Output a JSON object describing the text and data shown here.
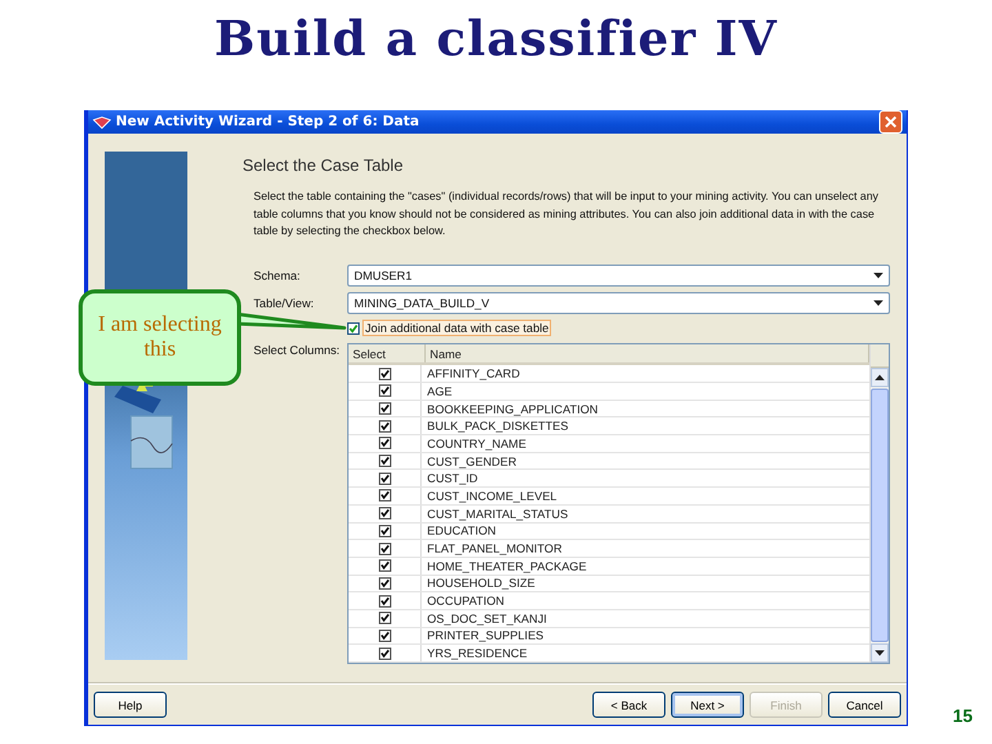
{
  "slide": {
    "title": "Build a classifier IV",
    "page_number": "15"
  },
  "callout": {
    "text": "I am selecting this"
  },
  "window": {
    "title": "New Activity Wizard - Step 2 of 6: Data"
  },
  "step": {
    "heading": "Select the Case Table",
    "description": "Select the table containing the \"cases\" (individual records/rows) that will be input to your mining activity.  You can unselect any table columns that you know should not be considered as mining attributes.  You can also join additional data in with the case table by selecting the checkbox below."
  },
  "form": {
    "schema": {
      "label": "Schema:",
      "value": "DMUSER1"
    },
    "table_view": {
      "label": "Table/View:",
      "value": "MINING_DATA_BUILD_V"
    },
    "join": {
      "label": "Join additional data with case table",
      "checked": true
    },
    "columns_label": "Select Columns:"
  },
  "table": {
    "columns": [
      "Select",
      "Name"
    ],
    "rows": [
      {
        "checked": true,
        "name": "AFFINITY_CARD"
      },
      {
        "checked": true,
        "name": "AGE"
      },
      {
        "checked": true,
        "name": "BOOKKEEPING_APPLICATION"
      },
      {
        "checked": true,
        "name": "BULK_PACK_DISKETTES"
      },
      {
        "checked": true,
        "name": "COUNTRY_NAME"
      },
      {
        "checked": true,
        "name": "CUST_GENDER"
      },
      {
        "checked": true,
        "name": "CUST_ID"
      },
      {
        "checked": true,
        "name": "CUST_INCOME_LEVEL"
      },
      {
        "checked": true,
        "name": "CUST_MARITAL_STATUS"
      },
      {
        "checked": true,
        "name": "EDUCATION"
      },
      {
        "checked": true,
        "name": "FLAT_PANEL_MONITOR"
      },
      {
        "checked": true,
        "name": "HOME_THEATER_PACKAGE"
      },
      {
        "checked": true,
        "name": "HOUSEHOLD_SIZE"
      },
      {
        "checked": true,
        "name": "OCCUPATION"
      },
      {
        "checked": true,
        "name": "OS_DOC_SET_KANJI"
      },
      {
        "checked": true,
        "name": "PRINTER_SUPPLIES"
      },
      {
        "checked": true,
        "name": "YRS_RESIDENCE"
      }
    ]
  },
  "buttons": [
    {
      "label": "Help",
      "kind": "left",
      "disabled": false,
      "default": false
    },
    {
      "label": "< Back",
      "kind": "right",
      "disabled": false,
      "default": false
    },
    {
      "label": "Next >",
      "kind": "right",
      "disabled": false,
      "default": true
    },
    {
      "label": "Finish",
      "kind": "right",
      "disabled": true,
      "default": false
    },
    {
      "label": "Cancel",
      "kind": "right",
      "disabled": false,
      "default": false
    }
  ]
}
